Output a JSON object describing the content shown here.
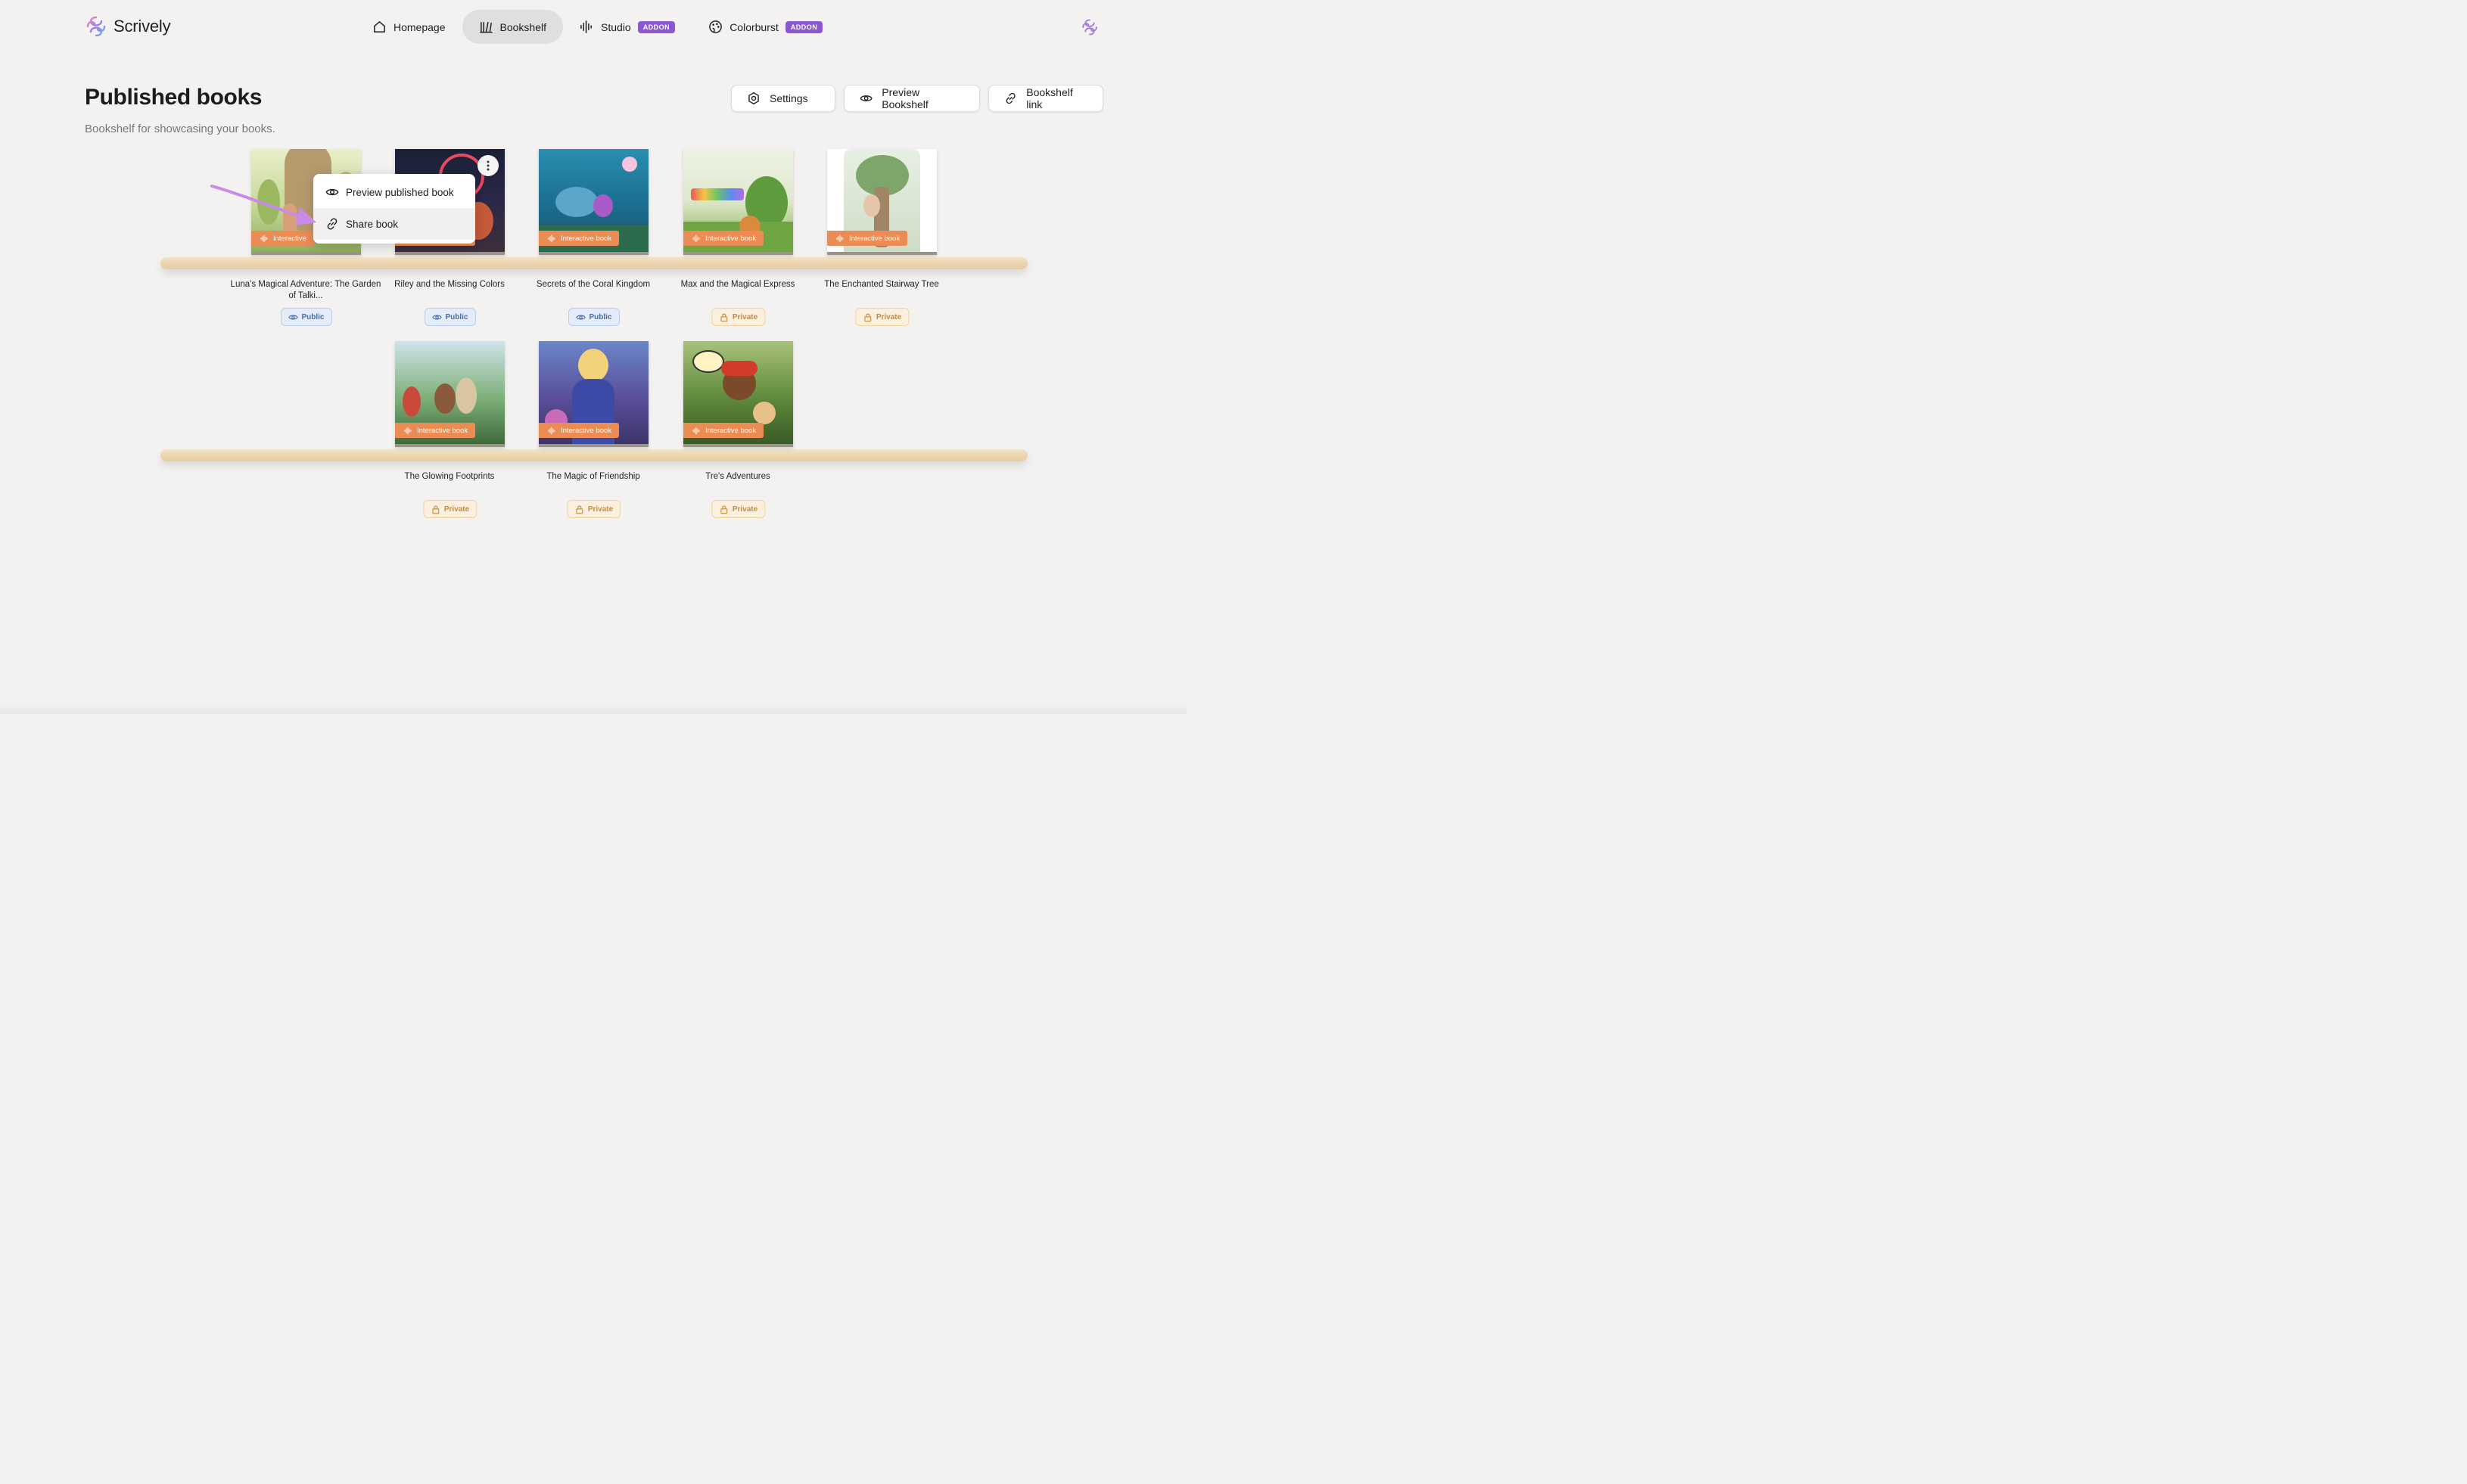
{
  "app": {
    "name": "Scrively"
  },
  "nav": {
    "items": [
      {
        "label": "Homepage",
        "icon": "home-icon",
        "active": false
      },
      {
        "label": "Bookshelf",
        "icon": "bookshelf-icon",
        "active": true
      },
      {
        "label": "Studio",
        "icon": "audio-wave-icon",
        "badge": "ADDON"
      },
      {
        "label": "Colorburst",
        "icon": "palette-icon",
        "badge": "ADDON"
      }
    ]
  },
  "page": {
    "title": "Published books",
    "subtitle": "Bookshelf for showcasing your books."
  },
  "actions": {
    "settings": "Settings",
    "preview": "Preview Bookshelf",
    "link": "Bookshelf link"
  },
  "menu": {
    "preview": "Preview published book",
    "share": "Share book"
  },
  "badge_label": "Interactive book",
  "badge_label_truncated": "Interactive",
  "books": [
    {
      "title": "Luna's Magical Adventure: The Garden of Talki...",
      "status": "Public"
    },
    {
      "title": "Riley and the Missing Colors",
      "status": "Public"
    },
    {
      "title": "Secrets of the Coral Kingdom",
      "status": "Public"
    },
    {
      "title": "Max and the Magical Express",
      "status": "Private"
    },
    {
      "title": "The Enchanted Stairway Tree",
      "status": "Private"
    },
    {
      "title": "The Glowing Footprints",
      "status": "Private"
    },
    {
      "title": "The Magic of Friendship",
      "status": "Private"
    },
    {
      "title": "Tre's Adventures",
      "status": "Private"
    }
  ],
  "colors": {
    "accent_purple": "#8a56d4",
    "badge_orange": "#ec8c55",
    "public_blue": "#4a6fa5",
    "private_amber": "#c98a3a"
  }
}
